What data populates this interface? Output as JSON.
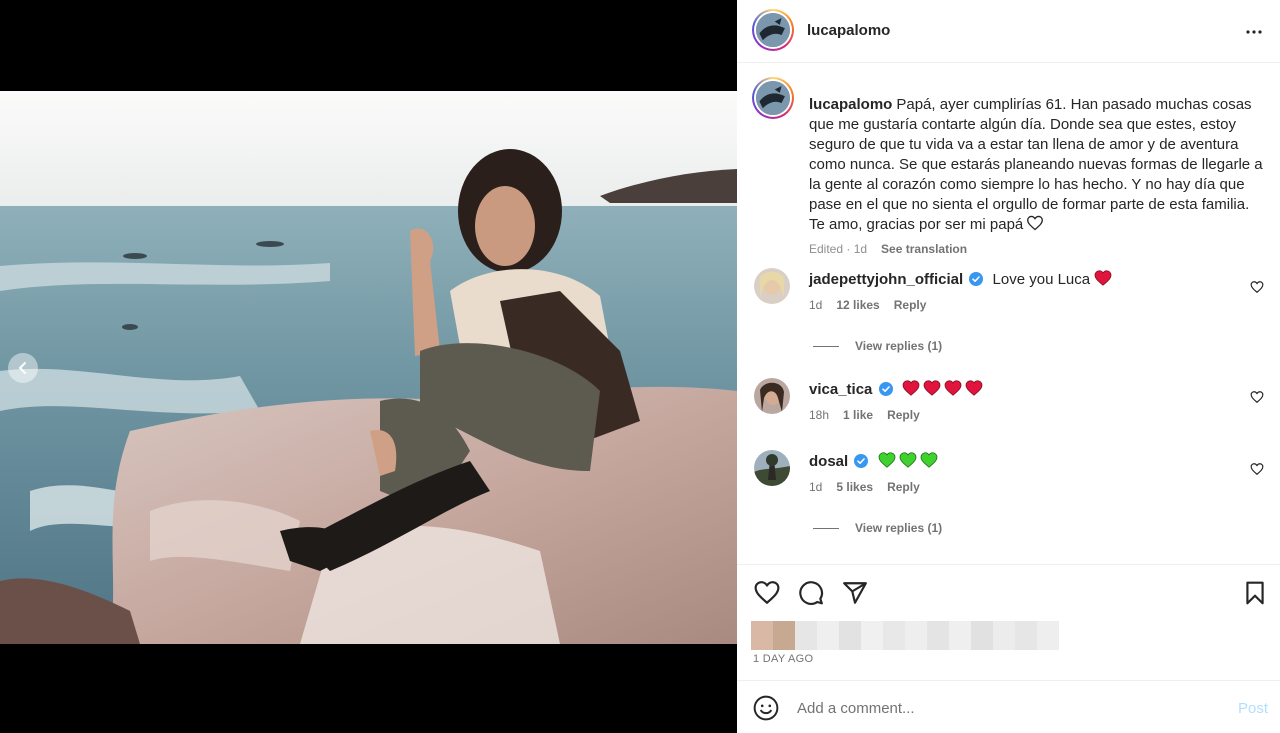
{
  "post": {
    "username": "lucapalomo",
    "caption": "Papá, ayer cumplirías 61. Han pasado muchas cosas que me gustaría contarte algún día. Donde sea que estes, estoy seguro de que tu vida va a estar tan llena de amor y de aventura como nunca. Se que estarás planeando nuevas formas de llegarle a la gente al corazón como siempre lo has hecho. Y no hay día que pase en el que no sienta el orgullo de formar parte de esta familia. Te amo, gracias por ser mi papá",
    "caption_meta": "Edited · 1d",
    "see_translation": "See translation",
    "timestamp": "1 DAY AGO"
  },
  "comments": [
    {
      "username": "jadepettyjohn_official",
      "verified": true,
      "text": "Love you Luca",
      "emoji": [
        "red-heart"
      ],
      "age": "1d",
      "likes": "12 likes",
      "reply": "Reply",
      "view_replies": "View replies (1)"
    },
    {
      "username": "vica_tica",
      "verified": true,
      "text": "",
      "emoji": [
        "red-heart",
        "red-heart",
        "red-heart",
        "red-heart"
      ],
      "age": "18h",
      "likes": "1 like",
      "reply": "Reply",
      "view_replies": ""
    },
    {
      "username": "dosal",
      "verified": true,
      "text": "",
      "emoji": [
        "green-heart",
        "green-heart",
        "green-heart"
      ],
      "age": "1d",
      "likes": "5 likes",
      "reply": "Reply",
      "view_replies": "View replies (1)"
    }
  ],
  "comment_box": {
    "placeholder": "Add a comment...",
    "post_label": "Post"
  },
  "icons": {
    "more": "more-horizontal-icon",
    "like": "heart-outline-icon",
    "comment": "comment-bubble-icon",
    "share": "paper-plane-icon",
    "save": "bookmark-icon",
    "emoji": "smiley-face-icon",
    "prev": "chevron-left-icon",
    "verified": "verified-badge-icon"
  },
  "colors": {
    "verified": "#3897f0",
    "red_heart": "#e0143c",
    "green_heart": "#3fd12e",
    "post_button_disabled": "#b2dffc"
  }
}
